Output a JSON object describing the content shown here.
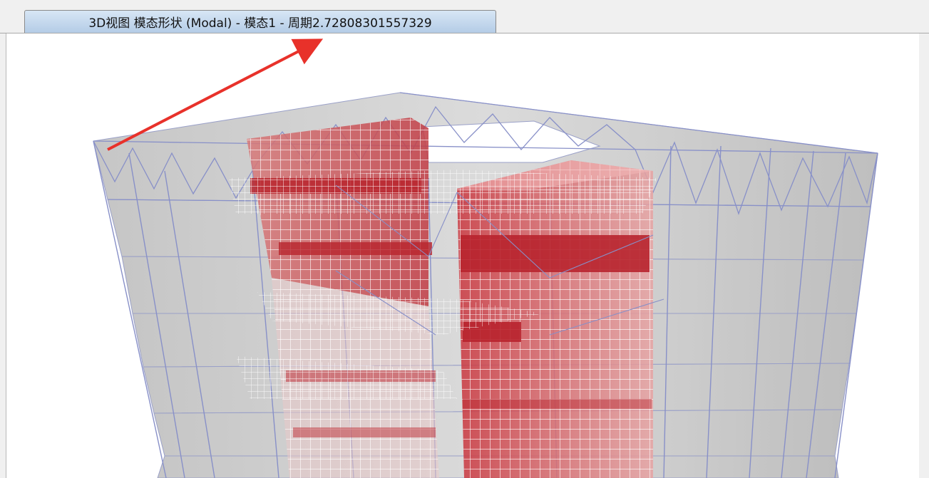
{
  "window": {
    "tab_title": "3D视图  模态形状 (Modal) - 模态1 - 周期2.72808301557329"
  },
  "viewport": {
    "view": "3D模态形状",
    "colors": {
      "floor_slab": "#8c8c8c",
      "frame_line": "#8890c8",
      "mesh_line": "#ffffff",
      "core_wall": "#c9323a",
      "annotation_arrow": "#e8312a"
    }
  }
}
